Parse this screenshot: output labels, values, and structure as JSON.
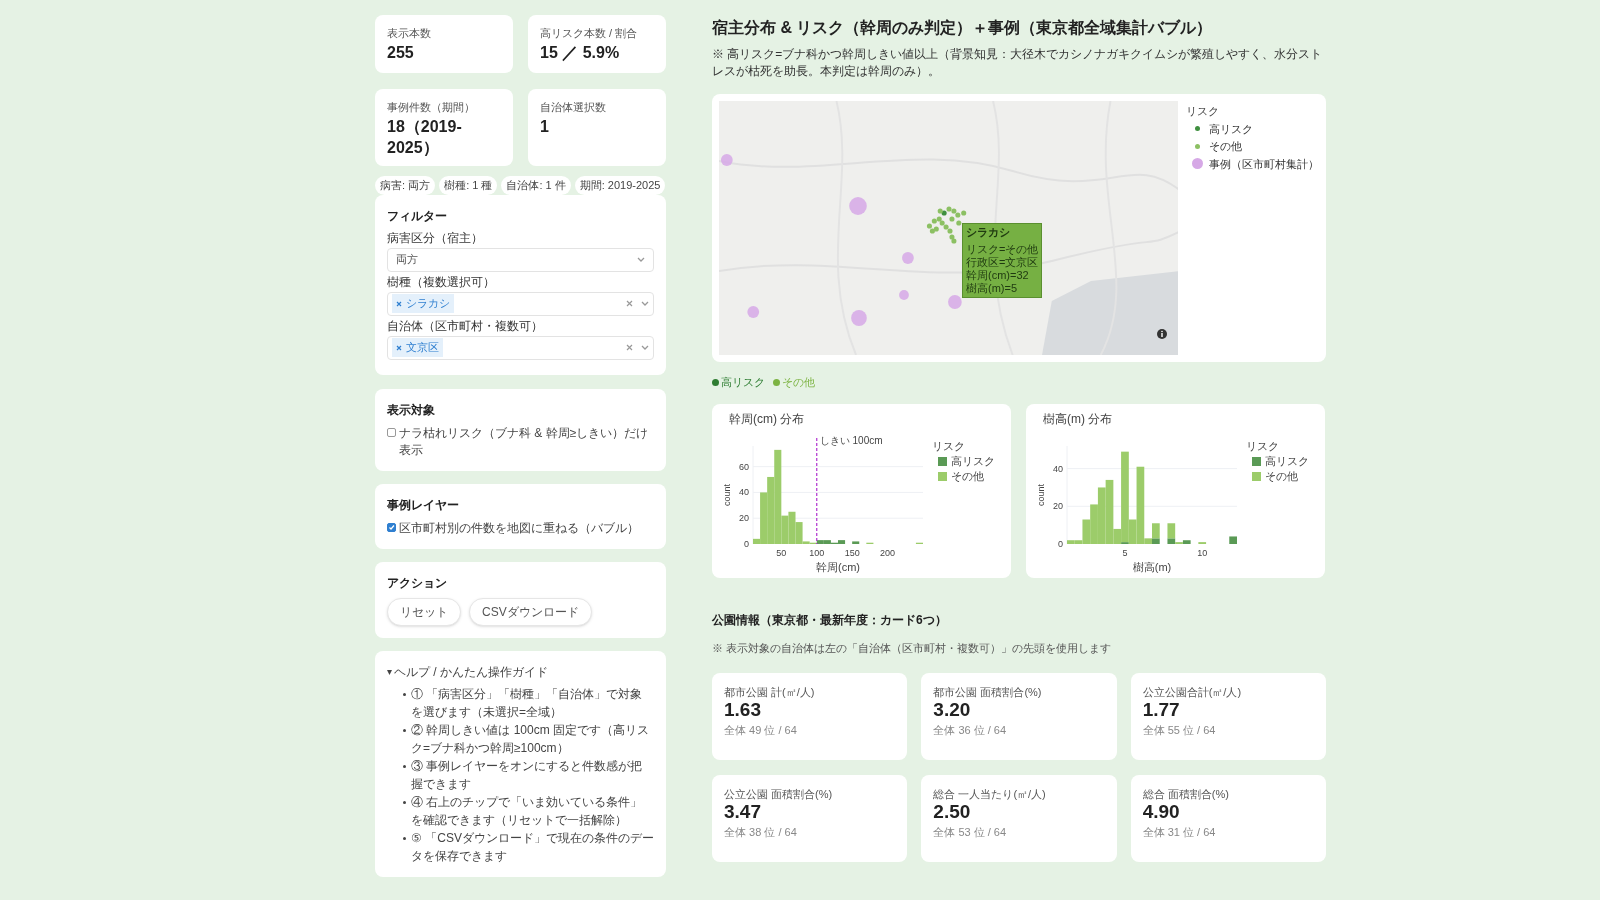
{
  "kpis": [
    {
      "label": "表示本数",
      "value": "255"
    },
    {
      "label": "高リスク本数 / 割合",
      "value": "15 ／ 5.9%"
    },
    {
      "label": "事例件数（期間）",
      "value": "18（2019-2025）"
    },
    {
      "label": "自治体選択数",
      "value": "1"
    }
  ],
  "chips": [
    "病害: 両方",
    "樹種: 1 種",
    "自治体: 1 件",
    "期間: 2019-2025"
  ],
  "filter": {
    "title": "フィルター",
    "fields": [
      {
        "kind": "select",
        "label": "病害区分（宿主）",
        "value": "両方"
      },
      {
        "kind": "multi",
        "label": "樹種（複数選択可）",
        "tags": [
          "シラカシ"
        ]
      },
      {
        "kind": "multi",
        "label": "自治体（区市町村・複数可）",
        "tags": [
          "文京区"
        ]
      }
    ]
  },
  "display": {
    "title": "表示対象",
    "label": "ナラ枯れリスク（ブナ科 & 幹周≥しきい）だけ表示",
    "checked": false
  },
  "case_layer": {
    "title": "事例レイヤー",
    "label": "区市町村別の件数を地図に重ねる（バブル）",
    "checked": true
  },
  "actions": {
    "title": "アクション",
    "buttons": [
      "リセット",
      "CSVダウンロード"
    ]
  },
  "help": {
    "toggle": "▾",
    "title": "ヘルプ / かんたん操作ガイド",
    "expanded": true,
    "items": [
      "① 「病害区分」「樹種」「自治体」で対象を選びます（未選択=全域）",
      "② 幹周しきい値は 100cm 固定です（高リスク=ブナ科かつ幹周≥100cm）",
      "③ 事例レイヤーをオンにすると件数感が把握できます",
      "④ 右上のチップで「いま効いている条件」を確認できます（リセットで一括解除）",
      "⑤ 「CSVダウンロード」で現在の条件のデータを保存できます"
    ]
  },
  "main": {
    "title": "宿主分布 & リスク（幹周のみ判定）＋事例（東京都全域集計バブル）",
    "note": "※ 高リスク=ブナ科かつ幹周しきい値以上（背景知見：大径木でカシノナガキクイムシが繁殖しやすく、水分ストレスが枯死を助長。本判定は幹周のみ）。"
  },
  "map": {
    "tooltip": {
      "title": "シラカシ",
      "lines": [
        "リスク=その他",
        "行政区=文京区",
        "幹周(cm)=32",
        "樹高(m)=5"
      ]
    },
    "legend": {
      "title": "リスク",
      "items": [
        {
          "label": "高リスク",
          "color": "#3f8f3f",
          "kind": "dot"
        },
        {
          "label": "その他",
          "color": "#8cc063",
          "kind": "dot"
        },
        {
          "label": "事例（区市町村集計）",
          "color": "#d6a8e6",
          "kind": "bubble"
        }
      ]
    }
  },
  "risk_legend": [
    {
      "label": "高リスク",
      "color": "#2e7d32"
    },
    {
      "label": "その他",
      "color": "#7cb342"
    }
  ],
  "charts": [
    {
      "chart_data": {
        "type": "bar",
        "stacked": true,
        "title": "幹周(cm) 分布",
        "xlabel": "幹周(cm)",
        "ylabel": "count",
        "legend_title": "リスク",
        "xlim": [
          10,
          250
        ],
        "ylim": [
          0,
          76
        ],
        "grid": true,
        "legend": true,
        "xticks": [
          50,
          100,
          150,
          200
        ],
        "yticks": [
          0,
          20,
          40,
          60
        ],
        "x": [
          15,
          25,
          35,
          45,
          55,
          65,
          75,
          85,
          95,
          105,
          115,
          125,
          135,
          155,
          175,
          245
        ],
        "series": [
          {
            "name": "高リスク",
            "color": "#5a9a55",
            "values": [
              0,
              0,
              0,
              0,
              0,
              0,
              0,
              0,
              0,
              3,
              3,
              1,
              3,
              2,
              0,
              0
            ]
          },
          {
            "name": "その他",
            "color": "#9ccc6a",
            "values": [
              4,
              40,
              52,
              73,
              22,
              25,
              17,
              2,
              1,
              0,
              0,
              0,
              0,
              0,
              1,
              1
            ]
          }
        ],
        "ref_lines": [
          {
            "axis": "x",
            "value": 100,
            "label": "しきい 100cm",
            "color": "#b02fcf"
          }
        ]
      }
    },
    {
      "chart_data": {
        "type": "bar",
        "stacked": true,
        "title": "樹高(m) 分布",
        "xlabel": "樹高(m)",
        "ylabel": "count",
        "legend_title": "リスク",
        "xlim": [
          1.25,
          12.25
        ],
        "ylim": [
          0,
          52
        ],
        "grid": true,
        "legend": true,
        "xticks": [
          5,
          10
        ],
        "yticks": [
          0,
          20,
          40
        ],
        "x": [
          1.5,
          2,
          2.5,
          3,
          3.5,
          4,
          4.5,
          5,
          5.5,
          6,
          6.5,
          7,
          8,
          8.5,
          9,
          10,
          12
        ],
        "series": [
          {
            "name": "高リスク",
            "color": "#5a9a55",
            "values": [
              0,
              0,
              0,
              0,
              0,
              0,
              0,
              1,
              0,
              0,
              0,
              3,
              3,
              0,
              2,
              0,
              4
            ]
          },
          {
            "name": "その他",
            "color": "#9ccc6a",
            "values": [
              2,
              2,
              13,
              21,
              30,
              34,
              8,
              48,
              13,
              41,
              3,
              8,
              8,
              1,
              0,
              1,
              0
            ]
          }
        ]
      }
    }
  ],
  "parks": {
    "title": "公園情報（東京都・最新年度：カード6つ）",
    "note": "※ 表示対象の自治体は左の「自治体（区市町村・複数可）」の先頭を使用します",
    "cards": [
      {
        "label": "都市公園 計(㎡/人)",
        "value": "1.63",
        "rank": "全体 49 位 / 64"
      },
      {
        "label": "都市公園 面積割合(%)",
        "value": "3.20",
        "rank": "全体 36 位 / 64"
      },
      {
        "label": "公立公園合計(㎡/人)",
        "value": "1.77",
        "rank": "全体 55 位 / 64"
      },
      {
        "label": "公立公園 面積割合(%)",
        "value": "3.47",
        "rank": "全体 38 位 / 64"
      },
      {
        "label": "総合 一人当たり(㎡/人)",
        "value": "2.50",
        "rank": "全体 53 位 / 64"
      },
      {
        "label": "総合 面積割合(%)",
        "value": "4.90",
        "rank": "全体 31 位 / 64"
      }
    ]
  }
}
